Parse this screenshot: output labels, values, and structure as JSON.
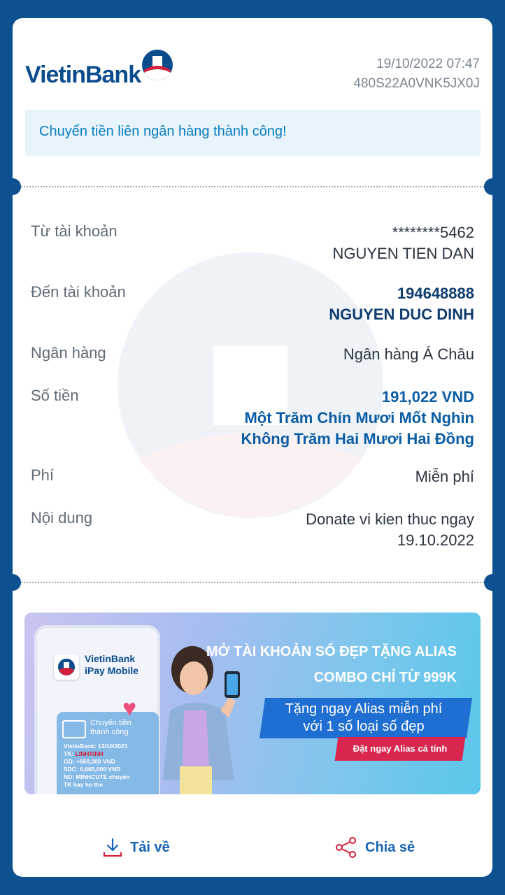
{
  "brand": {
    "name": "VietinBank"
  },
  "transaction": {
    "datetime": "19/10/2022 07:47",
    "reference": "480S22A0VNK5JX0J",
    "status_message": "Chuyển tiền liên ngân hàng thành công!"
  },
  "details": {
    "from": {
      "label": "Từ tài khoản",
      "account": "********5462",
      "name": "NGUYEN TIEN DAN"
    },
    "to": {
      "label": "Đến tài khoản",
      "account": "194648888",
      "name": "NGUYEN DUC DINH"
    },
    "bank": {
      "label": "Ngân hàng",
      "value": "Ngân hàng Á Châu"
    },
    "amount": {
      "label": "Số tiền",
      "value": "191,022 VND",
      "words_1": "Một Trăm Chín Mươi Mốt Nghìn",
      "words_2": "Không Trăm Hai Mươi Hai Đồng"
    },
    "fee": {
      "label": "Phí",
      "value": "Miễn phí"
    },
    "content": {
      "label": "Nội dung",
      "line_1": "Donate vi kien thuc ngay",
      "line_2": "19.10.2022"
    }
  },
  "promo": {
    "app_name_1": "VietinBank",
    "app_name_2": "iPay Mobile",
    "msg_title_1": "Chuyển tiền",
    "msg_title_2": "thành công",
    "msg_line_1": "VietinBank: 13/10/2021",
    "msg_line_2_prefix": "TK: ",
    "msg_line_2_value": "LINHXINH",
    "msg_line_3": "GD: +660,000 VND",
    "msg_line_4": "SDC: 6,660,000 VND",
    "msg_line_5": "ND: MINHCUTE chuyen",
    "msg_line_6": "TK hay ho the",
    "headline_1": "MỞ TÀI KHOẢN SỐ ĐẸP TẶNG ALIAS",
    "headline_2": "COMBO CHỈ TỪ 999K",
    "offer_1": "Tặng ngay Alias miễn phí",
    "offer_2": "với 1 số loại số đẹp",
    "cta": "Đặt ngay Alias cá tính"
  },
  "actions": {
    "download": "Tải về",
    "share": "Chia sẻ"
  },
  "colors": {
    "primary": "#0e5190",
    "accent": "#0a7cc1",
    "brand_red": "#d21f3c"
  }
}
